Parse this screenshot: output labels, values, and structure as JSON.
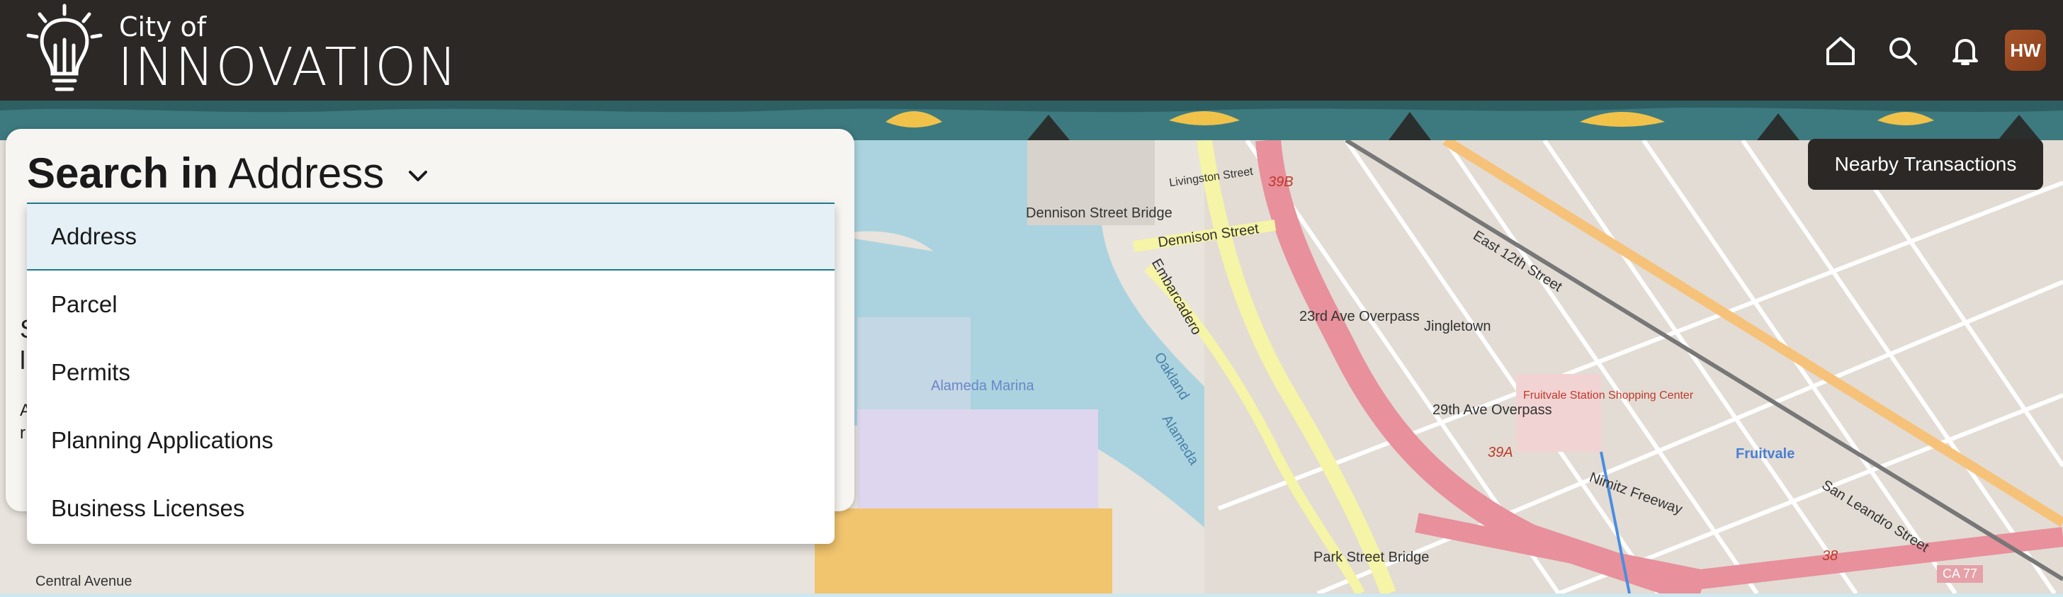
{
  "brand": {
    "small": "City of",
    "big": "INNOVATION"
  },
  "header": {
    "avatar_initials": "HW"
  },
  "search": {
    "prefix": "Search in",
    "selected": "Address",
    "options": [
      "Address",
      "Parcel",
      "Permits",
      "Planning Applications",
      "Business Licenses"
    ]
  },
  "map": {
    "button": "Nearby Transactions",
    "labels": [
      "Dennison Street Bridge",
      "Dennison Street",
      "Livingston Street",
      "Embarcadero",
      "23rd Ave Overpass",
      "Jingletown",
      "Alameda Marina",
      "Oakland",
      "Alameda",
      "29th Ave Overpass",
      "Fruitvale Station Shopping Center",
      "Fruitvale",
      "Nimitz Freeway",
      "East 12th Street",
      "San Leandro Street",
      "Park Street Bridge",
      "Central Avenue",
      "CA 77",
      "39B",
      "39A",
      "38"
    ]
  },
  "colors": {
    "topbar": "#2b2826",
    "water": "#aad3df",
    "accent": "#1e7a8e",
    "avatar": "#a9552a"
  }
}
